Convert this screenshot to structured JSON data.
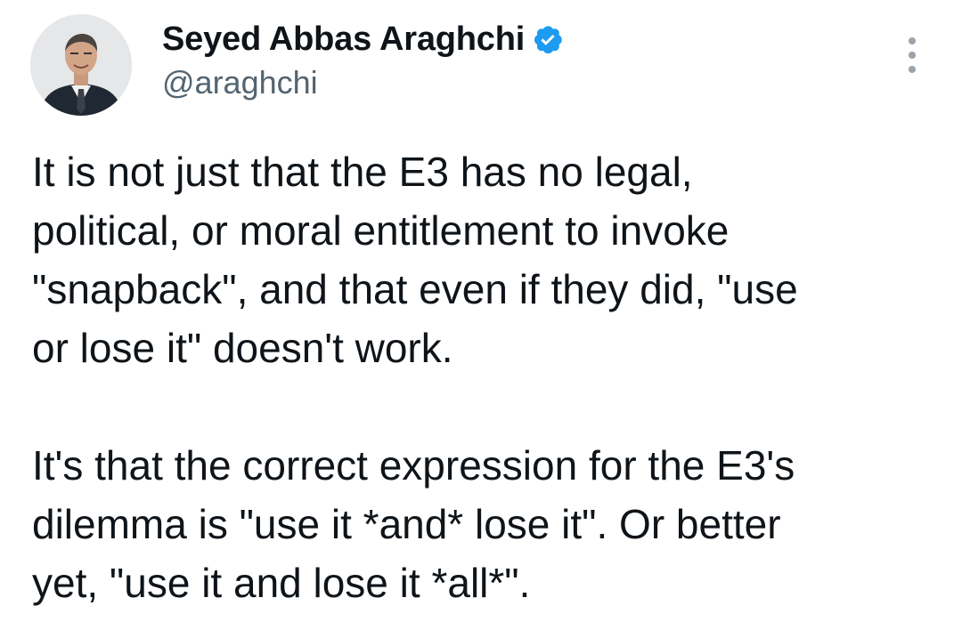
{
  "author": {
    "display_name": "Seyed Abbas Araghchi",
    "handle": "@araghchi",
    "verified": true,
    "avatar_icon": "profile-photo"
  },
  "menu": {
    "icon": "more-options-icon"
  },
  "tweet": {
    "paragraphs": [
      "It is not just that the E3 has no legal,\npolitical, or moral entitlement to invoke\n\"snapback\", and that even if they did, \"use\nor lose it\" doesn't work.",
      "It's that the correct expression for the E3's\ndilemma is \"use it *and* lose it\". Or better\nyet, \"use it and lose it *all*\"."
    ]
  },
  "colors": {
    "text": "#0f1419",
    "secondary_text": "#536471",
    "verified_badge": "#1d9bf0",
    "menu_dots": "#9aa3ab"
  }
}
